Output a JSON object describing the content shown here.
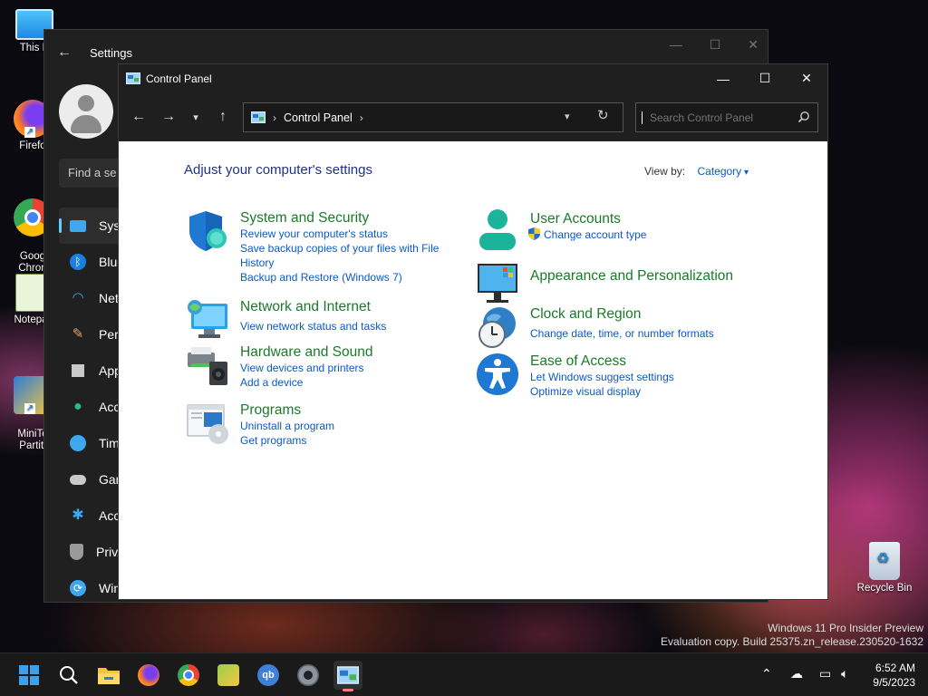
{
  "desktop": {
    "icons": [
      {
        "label": "This P"
      },
      {
        "label": "Firefo"
      },
      {
        "label": "Goog\nChron"
      },
      {
        "label": "Notepa"
      },
      {
        "label": "MiniTo\nPartiti"
      },
      {
        "label": "Recycle Bin"
      }
    ],
    "watermark": {
      "line1": "Windows 11 Pro Insider Preview",
      "line2": "Evaluation copy. Build 25375.zn_release.230520-1632"
    }
  },
  "settings": {
    "title": "Settings",
    "find_placeholder": "Find a se",
    "nav": [
      {
        "label": "Syste",
        "icon": "monitor-icon",
        "color": "#3da7f0"
      },
      {
        "label": "Blueto",
        "icon": "bluetooth-icon",
        "color": "#1a7fe0"
      },
      {
        "label": "Netw",
        "icon": "wifi-icon",
        "color": "#3da7f0"
      },
      {
        "label": "Perso",
        "icon": "brush-icon",
        "color": "#e8a36b"
      },
      {
        "label": "Apps",
        "icon": "apps-icon",
        "color": "#c9c9c9"
      },
      {
        "label": "Acco",
        "icon": "account-icon",
        "color": "#2fb884"
      },
      {
        "label": "Time",
        "icon": "clock-icon",
        "color": "#3da7f0"
      },
      {
        "label": "Gami",
        "icon": "gamepad-icon",
        "color": "#c9c9c9"
      },
      {
        "label": "Acce",
        "icon": "accessibility-icon",
        "color": "#3da7f0"
      },
      {
        "label": "Priva",
        "icon": "shield-icon",
        "color": "#9a9a9a"
      },
      {
        "label": "Wind",
        "icon": "update-icon",
        "color": "#3da7f0"
      }
    ]
  },
  "control_panel": {
    "title": "Control Panel",
    "address": "Control Panel",
    "search_placeholder": "Search Control Panel",
    "heading": "Adjust your computer's settings",
    "view_by_label": "View by:",
    "view_by_value": "Category",
    "categories_left": [
      {
        "title": "System and Security",
        "icon": "system-security-icon",
        "links": [
          "Review your computer's status",
          "Save backup copies of your files with File History",
          "Backup and Restore (Windows 7)"
        ]
      },
      {
        "title": "Network and Internet",
        "icon": "network-internet-icon",
        "links": [
          "View network status and tasks"
        ]
      },
      {
        "title": "Hardware and Sound",
        "icon": "hardware-sound-icon",
        "links": [
          "View devices and printers",
          "Add a device"
        ]
      },
      {
        "title": "Programs",
        "icon": "programs-icon",
        "links": [
          "Uninstall a program",
          "Get programs"
        ]
      }
    ],
    "categories_right": [
      {
        "title": "User Accounts",
        "icon": "user-accounts-icon",
        "links": [
          "Change account type"
        ]
      },
      {
        "title": "Appearance and Personalization",
        "icon": "appearance-icon",
        "links": []
      },
      {
        "title": "Clock and Region",
        "icon": "clock-region-icon",
        "links": [
          "Change date, time, or number formats"
        ]
      },
      {
        "title": "Ease of Access",
        "icon": "ease-of-access-icon",
        "links": [
          "Let Windows suggest settings",
          "Optimize visual display"
        ]
      }
    ]
  },
  "taskbar": {
    "time": "6:52 AM",
    "date": "9/5/2023"
  }
}
